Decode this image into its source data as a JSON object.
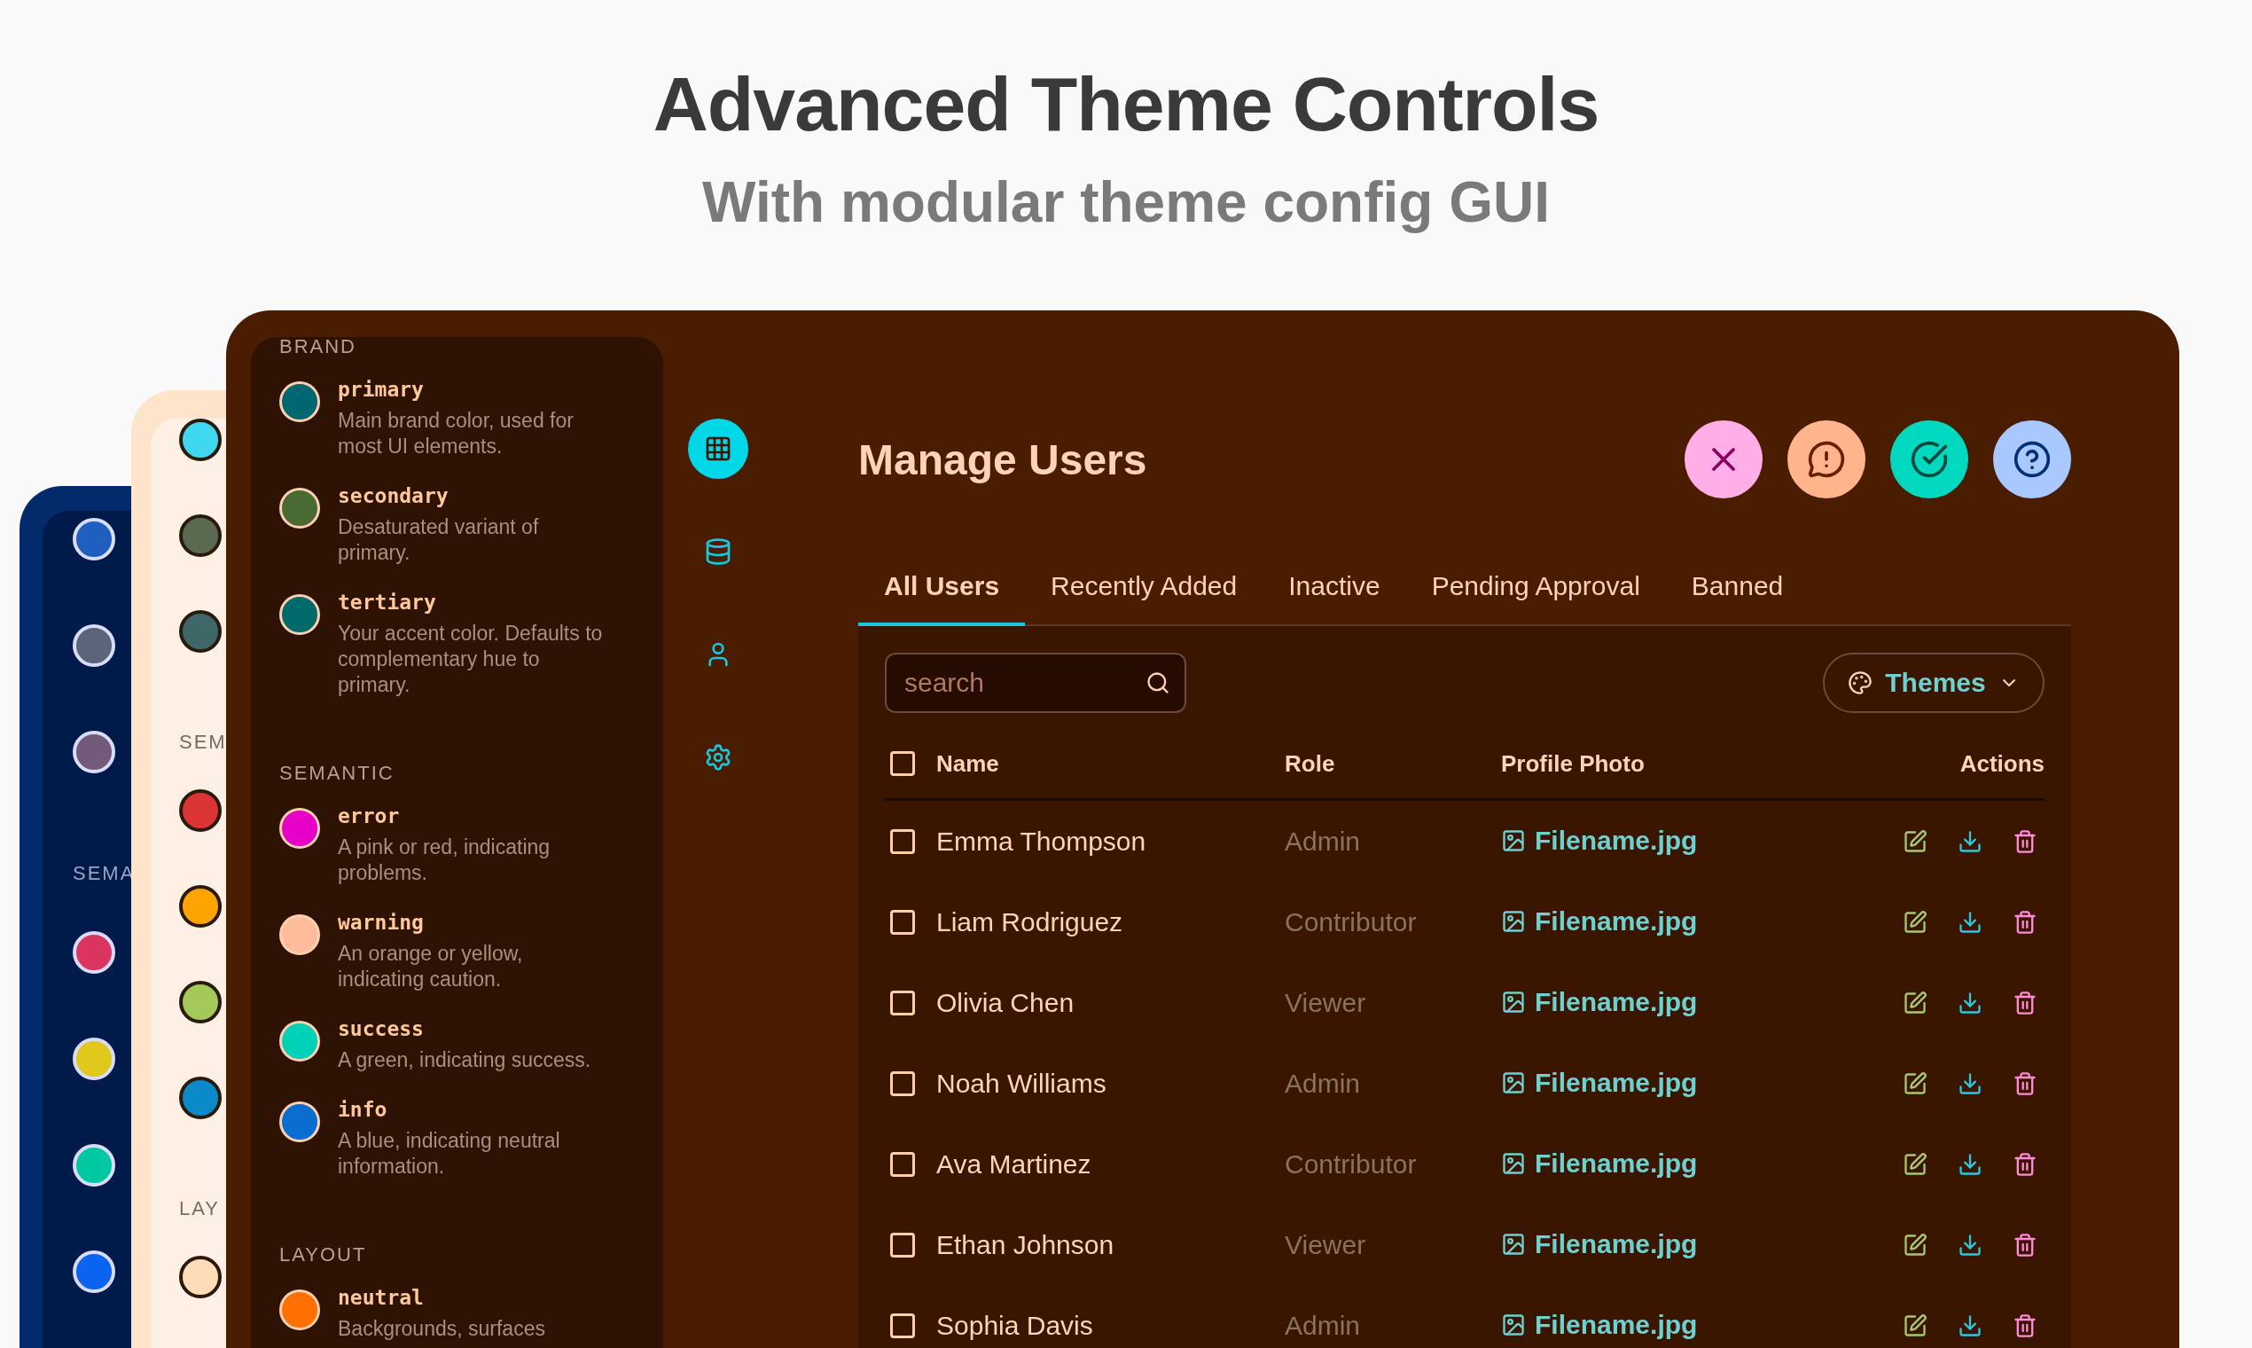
{
  "header": {
    "title": "Advanced Theme Controls",
    "subtitle": "With modular theme config GUI"
  },
  "back_panels": [
    {
      "kind": "navy",
      "items": [
        {
          "kind": "swatch",
          "color": "#1f5fbf"
        },
        {
          "kind": "swatch",
          "color": "#5b6478"
        },
        {
          "kind": "swatch",
          "color": "#735a7a"
        },
        {
          "kind": "label",
          "text": "SEMA"
        },
        {
          "kind": "swatch",
          "color": "#dc3460"
        },
        {
          "kind": "swatch",
          "color": "#e0c81c"
        },
        {
          "kind": "swatch",
          "color": "#00c8a0"
        },
        {
          "kind": "swatch",
          "color": "#0a64f0"
        }
      ]
    },
    {
      "kind": "cream",
      "items": [
        {
          "kind": "swatch",
          "color": "#40d8f0"
        },
        {
          "kind": "swatch",
          "color": "#5a6a50"
        },
        {
          "kind": "swatch",
          "color": "#3e6868"
        },
        {
          "kind": "label",
          "text": "SEM"
        },
        {
          "kind": "swatch",
          "color": "#dc3434"
        },
        {
          "kind": "swatch",
          "color": "#ffa400"
        },
        {
          "kind": "swatch",
          "color": "#a4c85a"
        },
        {
          "kind": "swatch",
          "color": "#0a8ac8"
        },
        {
          "kind": "label",
          "text": "LAY"
        },
        {
          "kind": "swatch",
          "color": "#ffdcb8"
        }
      ]
    }
  ],
  "sidebar": {
    "sections": [
      {
        "title": "BRAND",
        "tokens": [
          {
            "name": "primary",
            "description": "Main brand color, used for most UI elements.",
            "color": "#006670"
          },
          {
            "name": "secondary",
            "description": "Desaturated variant of primary.",
            "color": "#4a6a34"
          },
          {
            "name": "tertiary",
            "description": "Your accent color. Defaults to complementary hue to primary.",
            "color": "#006a6a"
          }
        ]
      },
      {
        "title": "SEMANTIC",
        "tokens": [
          {
            "name": "error",
            "description": "A pink or red, indicating problems.",
            "color": "#e600c8"
          },
          {
            "name": "warning",
            "description": "An orange or yellow, indicating caution.",
            "color": "#ffbc9c"
          },
          {
            "name": "success",
            "description": "A green, indicating success.",
            "color": "#00d2b8"
          },
          {
            "name": "info",
            "description": "A blue, indicating neutral information.",
            "color": "#0a6ed0"
          }
        ]
      },
      {
        "title": "LAYOUT",
        "tokens": [
          {
            "name": "neutral",
            "description": "Backgrounds, surfaces",
            "color": "#ff7000"
          }
        ]
      }
    ]
  },
  "nav": [
    {
      "kind": "table",
      "selected": true
    },
    {
      "kind": "database",
      "selected": false
    },
    {
      "kind": "user",
      "selected": false
    },
    {
      "kind": "settings",
      "selected": false
    }
  ],
  "page_title": "Manage Users",
  "action_buttons": [
    {
      "kind": "close",
      "color": "#ffaee8"
    },
    {
      "kind": "alert",
      "color": "#ffb48c"
    },
    {
      "kind": "check",
      "color": "#00d8c0"
    },
    {
      "kind": "help",
      "color": "#a8c8ff"
    }
  ],
  "tabs": [
    {
      "label": "All Users",
      "selected": true
    },
    {
      "label": "Recently Added",
      "selected": false
    },
    {
      "label": "Inactive",
      "selected": false
    },
    {
      "label": "Pending Approval",
      "selected": false
    },
    {
      "label": "Banned",
      "selected": false
    }
  ],
  "search": {
    "placeholder": "search"
  },
  "themes_button": {
    "label": "Themes"
  },
  "table": {
    "select_all_checked": false,
    "columns": [
      "Name",
      "Role",
      "Profile Photo",
      "Actions"
    ],
    "rows": [
      {
        "checked": false,
        "name": "Emma Thompson",
        "role": "Admin",
        "photo": "Filename.jpg"
      },
      {
        "checked": false,
        "name": "Liam Rodriguez",
        "role": "Contributor",
        "photo": "Filename.jpg"
      },
      {
        "checked": false,
        "name": "Olivia Chen",
        "role": "Viewer",
        "photo": "Filename.jpg"
      },
      {
        "checked": false,
        "name": "Noah Williams",
        "role": "Admin",
        "photo": "Filename.jpg"
      },
      {
        "checked": false,
        "name": "Ava Martinez",
        "role": "Contributor",
        "photo": "Filename.jpg"
      },
      {
        "checked": false,
        "name": "Ethan Johnson",
        "role": "Viewer",
        "photo": "Filename.jpg"
      },
      {
        "checked": false,
        "name": "Sophia Davis",
        "role": "Admin",
        "photo": "Filename.jpg"
      }
    ]
  }
}
